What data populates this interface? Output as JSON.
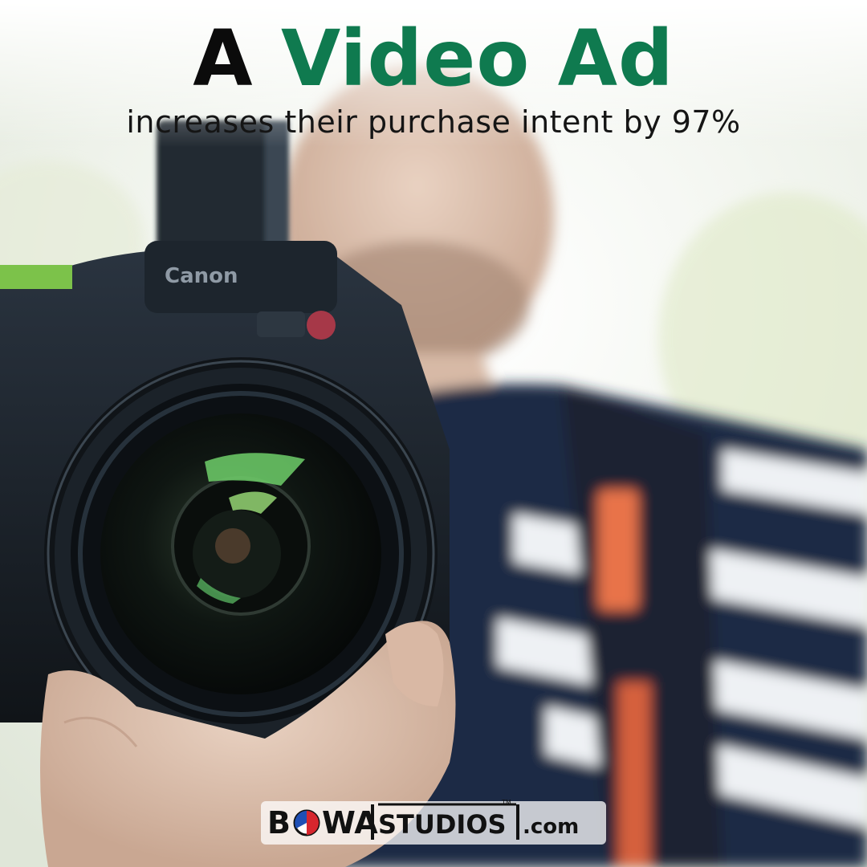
{
  "headline": {
    "word_a": "A",
    "word_b": "Video Ad"
  },
  "subheadline": "increases their purchase intent by 97%",
  "logo": {
    "b": "B",
    "wa": "WA",
    "studios": "STUDIOS",
    "dotcom": ".com",
    "tm": "TM"
  },
  "camera": {
    "brand": "Canon"
  },
  "colors": {
    "accent_green": "#0f7a4f",
    "text_dark": "#0b0b0b",
    "logo_red": "#d7262e",
    "logo_blue": "#1f4fb5"
  }
}
